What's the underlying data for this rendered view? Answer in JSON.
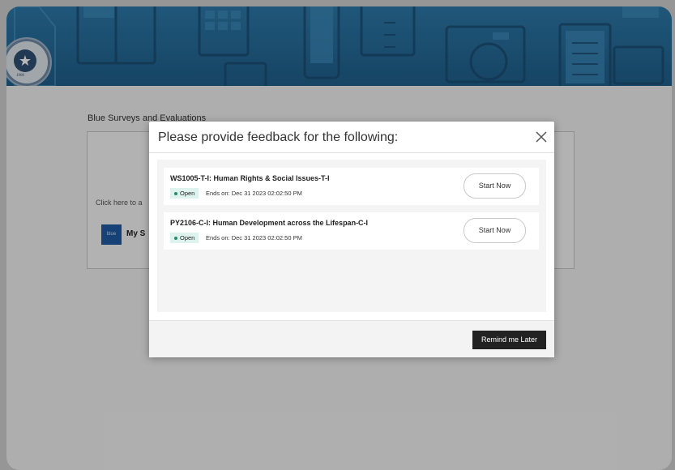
{
  "page": {
    "section_title": "Blue Surveys and Evaluations",
    "panel_hint": "Click here to a",
    "panel_item_label": "My S",
    "logo_text": "blue"
  },
  "banner": {
    "seal_year": "1900"
  },
  "modal": {
    "title": "Please provide feedback for the following:",
    "close_icon": "close-icon",
    "remind_label": "Remind me Later",
    "surveys": [
      {
        "course": "WS1005-T-I: Human Rights & Social Issues-T-I",
        "status": "Open",
        "ends": "Ends on: Dec 31 2023 02:02:50 PM",
        "action": "Start Now"
      },
      {
        "course": "PY2106-C-I: Human Development across the Lifespan-C-I",
        "status": "Open",
        "ends": "Ends on: Dec 31 2023 02:02:50 PM",
        "action": "Start Now"
      }
    ]
  },
  "colors": {
    "banner": "#2d79a9",
    "badge_bg": "#dff3ee",
    "badge_dot": "#2a8a69",
    "primary_button": "#222222"
  }
}
